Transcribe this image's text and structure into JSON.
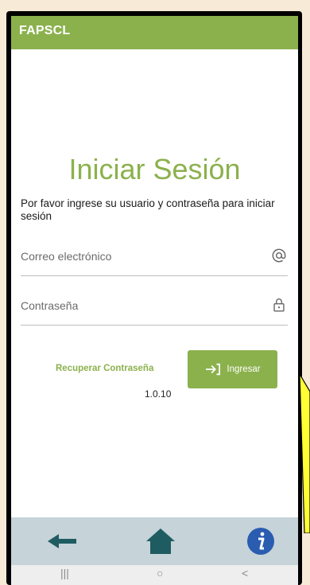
{
  "appbar": {
    "title": "FAPSCL"
  },
  "login": {
    "title": "Iniciar Sesión",
    "subtitle": "Por favor ingrese su usuario y contraseña para iniciar sesión",
    "email_label": "Correo electrónico",
    "password_label": "Contraseña",
    "recover_label": "Recuperar Contraseña",
    "login_label": "Ingresar",
    "version": "1.0.10"
  },
  "bottom_nav": {
    "items": [
      {
        "icon": "back-arrow-icon"
      },
      {
        "icon": "home-icon"
      },
      {
        "icon": "info-icon"
      }
    ]
  },
  "system_nav": {
    "recents": "|||",
    "home": "○",
    "back": "<"
  },
  "colors": {
    "accent": "#8bb14d",
    "bottom_nav_bg": "#c6d3d9",
    "nav_icon": "#1f5c61",
    "info_icon": "#2a5db0"
  }
}
